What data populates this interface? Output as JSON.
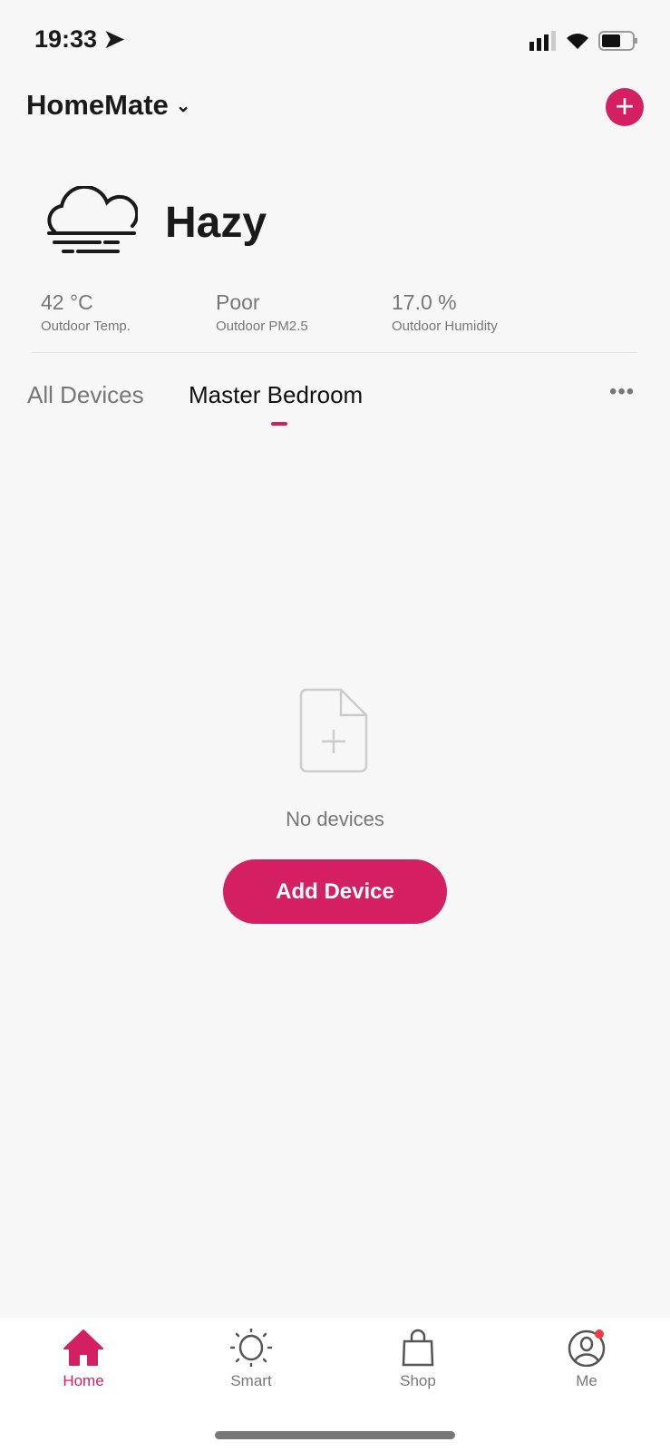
{
  "status_bar": {
    "time": "19:33"
  },
  "header": {
    "title": "HomeMate"
  },
  "weather": {
    "condition": "Hazy",
    "stats": [
      {
        "value": "42 °C",
        "label": "Outdoor Temp."
      },
      {
        "value": "Poor",
        "label": "Outdoor PM2.5"
      },
      {
        "value": "17.0 %",
        "label": "Outdoor Humidity"
      }
    ]
  },
  "tabs": [
    {
      "label": "All Devices",
      "active": false
    },
    {
      "label": "Master Bedroom",
      "active": true
    }
  ],
  "empty": {
    "message": "No devices",
    "button": "Add Device"
  },
  "nav": [
    {
      "label": "Home",
      "icon": "home-icon",
      "active": true
    },
    {
      "label": "Smart",
      "icon": "sun-icon"
    },
    {
      "label": "Shop",
      "icon": "bag-icon"
    },
    {
      "label": "Me",
      "icon": "user-icon",
      "badge": true
    }
  ],
  "colors": {
    "accent": "#d42063",
    "badge": "#f03c3c"
  }
}
